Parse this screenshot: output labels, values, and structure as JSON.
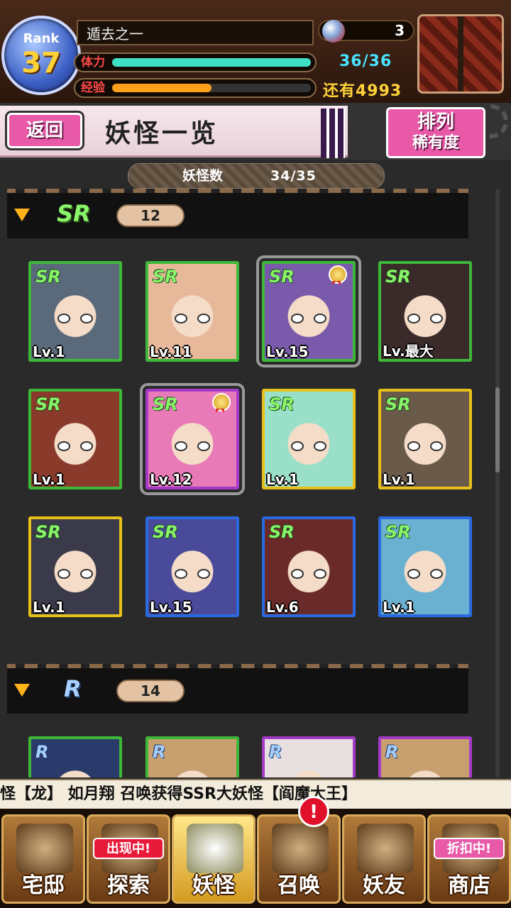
{
  "player": {
    "rank_label": "Rank",
    "rank": "37",
    "name": "遁去之一",
    "stamina_label": "体力",
    "stamina_value": "36/36",
    "stamina_fraction": 1.0,
    "exp_label": "经验",
    "exp_value": "还有4993",
    "exp_fraction": 0.5,
    "orbs": "3"
  },
  "header": {
    "back_label": "返回",
    "title": "妖怪一览",
    "sort_label": "排列",
    "sort_value": "稀有度"
  },
  "count": {
    "label": "妖怪数",
    "value": "34/35"
  },
  "sections": [
    {
      "rarity": "SR",
      "count": "12",
      "cards": [
        {
          "badge": "SR",
          "level": "Lv.1",
          "frame": "#3fb83a",
          "bg": "#5a6a7a",
          "selected": false,
          "medal": false
        },
        {
          "badge": "SR",
          "level": "Lv.11",
          "frame": "#3fb83a",
          "bg": "#e8b89a",
          "selected": false,
          "medal": false
        },
        {
          "badge": "SR",
          "level": "Lv.15",
          "frame": "#3fb83a",
          "bg": "#7a5aaa",
          "selected": true,
          "medal": true
        },
        {
          "badge": "SR",
          "level": "Lv.最大",
          "frame": "#3fb83a",
          "bg": "#3a2a2a",
          "selected": false,
          "medal": false
        },
        {
          "badge": "SR",
          "level": "Lv.1",
          "frame": "#3fb83a",
          "bg": "#8a3a2a",
          "selected": false,
          "medal": false
        },
        {
          "badge": "SR",
          "level": "Lv.12",
          "frame": "#a43ac8",
          "bg": "#e87ab8",
          "selected": true,
          "medal": true
        },
        {
          "badge": "SR",
          "level": "Lv.1",
          "frame": "#e8c01a",
          "bg": "#9ae0c8",
          "selected": false,
          "medal": false
        },
        {
          "badge": "SR",
          "level": "Lv.1",
          "frame": "#e8c01a",
          "bg": "#6a5a4a",
          "selected": false,
          "medal": false
        },
        {
          "badge": "SR",
          "level": "Lv.1",
          "frame": "#e8c01a",
          "bg": "#3a3a4a",
          "selected": false,
          "medal": false
        },
        {
          "badge": "SR",
          "level": "Lv.15",
          "frame": "#2a6ae0",
          "bg": "#4a4a9a",
          "selected": false,
          "medal": false
        },
        {
          "badge": "SR",
          "level": "Lv.6",
          "frame": "#2a6ae0",
          "bg": "#6a2a2a",
          "selected": false,
          "medal": false
        },
        {
          "badge": "SR",
          "level": "Lv.1",
          "frame": "#2a6ae0",
          "bg": "#6ab0d0",
          "selected": false,
          "medal": false
        }
      ]
    },
    {
      "rarity": "R",
      "count": "14",
      "cards": [
        {
          "badge": "R",
          "level": "",
          "frame": "#3fb83a",
          "bg": "#2a3a6a",
          "selected": false,
          "medal": false
        },
        {
          "badge": "R",
          "level": "",
          "frame": "#3fb83a",
          "bg": "#c8a070",
          "selected": false,
          "medal": false
        },
        {
          "badge": "R",
          "level": "",
          "frame": "#a43ac8",
          "bg": "#e8e0e0",
          "selected": false,
          "medal": false
        },
        {
          "badge": "R",
          "level": "",
          "frame": "#a43ac8",
          "bg": "#c8a070",
          "selected": false,
          "medal": false
        }
      ]
    }
  ],
  "ticker": "怪【龙】    如月翔 召唤获得SSR大妖怪【阎魔大王】",
  "nav": [
    {
      "label": "宅邸",
      "tag": "",
      "icon": "mansion-icon"
    },
    {
      "label": "探索",
      "tag": "出现中!",
      "icon": "explore-icon"
    },
    {
      "label": "妖怪",
      "tag": "",
      "icon": "yokai-scroll-icon",
      "active": true
    },
    {
      "label": "召唤",
      "tag": "",
      "icon": "pentagram-icon",
      "notif": "!"
    },
    {
      "label": "妖友",
      "tag": "",
      "icon": "friend-icon"
    },
    {
      "label": "商店",
      "tag": "折扣中!",
      "icon": "shop-orb-icon"
    }
  ],
  "colors": {
    "accent_pink": "#e85aa8",
    "stamina": "#49e3ff",
    "exp": "#ffd23a"
  }
}
